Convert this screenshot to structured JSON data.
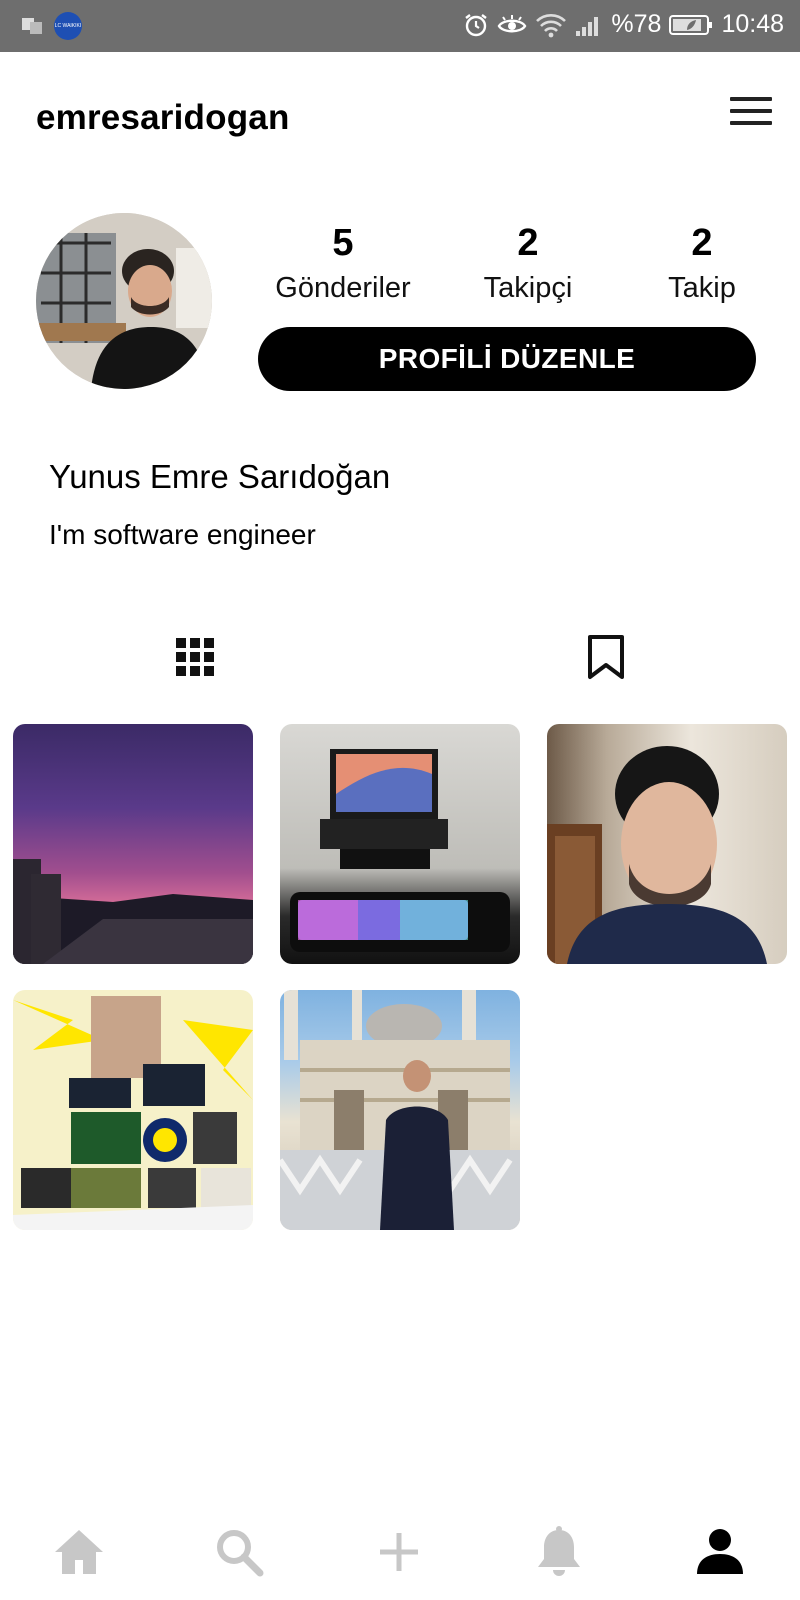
{
  "status_bar": {
    "app_badge": "LC WAIKIKI",
    "battery": "%78",
    "time": "10:48"
  },
  "header": {
    "username": "emresaridogan"
  },
  "profile": {
    "stats": [
      {
        "value": "5",
        "label": "Gönderiler"
      },
      {
        "value": "2",
        "label": "Takipçi"
      },
      {
        "value": "2",
        "label": "Takip"
      }
    ],
    "edit_button_label": "PROFİLİ DÜZENLE",
    "full_name": "Yunus Emre Sarıdoğan",
    "bio": "I'm software engineer"
  },
  "tabs": [
    {
      "icon": "grid-icon",
      "active": true
    },
    {
      "icon": "bookmark-icon",
      "active": false
    }
  ],
  "posts": [
    {
      "subject": "purple sunset sky over rooftops"
    },
    {
      "subject": "laptop with RGB keyboard on desk"
    },
    {
      "subject": "selfie portrait"
    },
    {
      "subject": "yellow football collage"
    },
    {
      "subject": "portrait in front of a mosque"
    }
  ],
  "bottom_nav": [
    {
      "icon": "home-icon",
      "active": false
    },
    {
      "icon": "search-icon",
      "active": false
    },
    {
      "icon": "add-icon",
      "active": false
    },
    {
      "icon": "bell-icon",
      "active": false
    },
    {
      "icon": "profile-icon",
      "active": true
    }
  ],
  "colors": {
    "status_bar_bg": "#6e6e6e",
    "button_bg": "#000000",
    "nav_inactive": "#c7c7c7",
    "nav_active": "#000000"
  }
}
